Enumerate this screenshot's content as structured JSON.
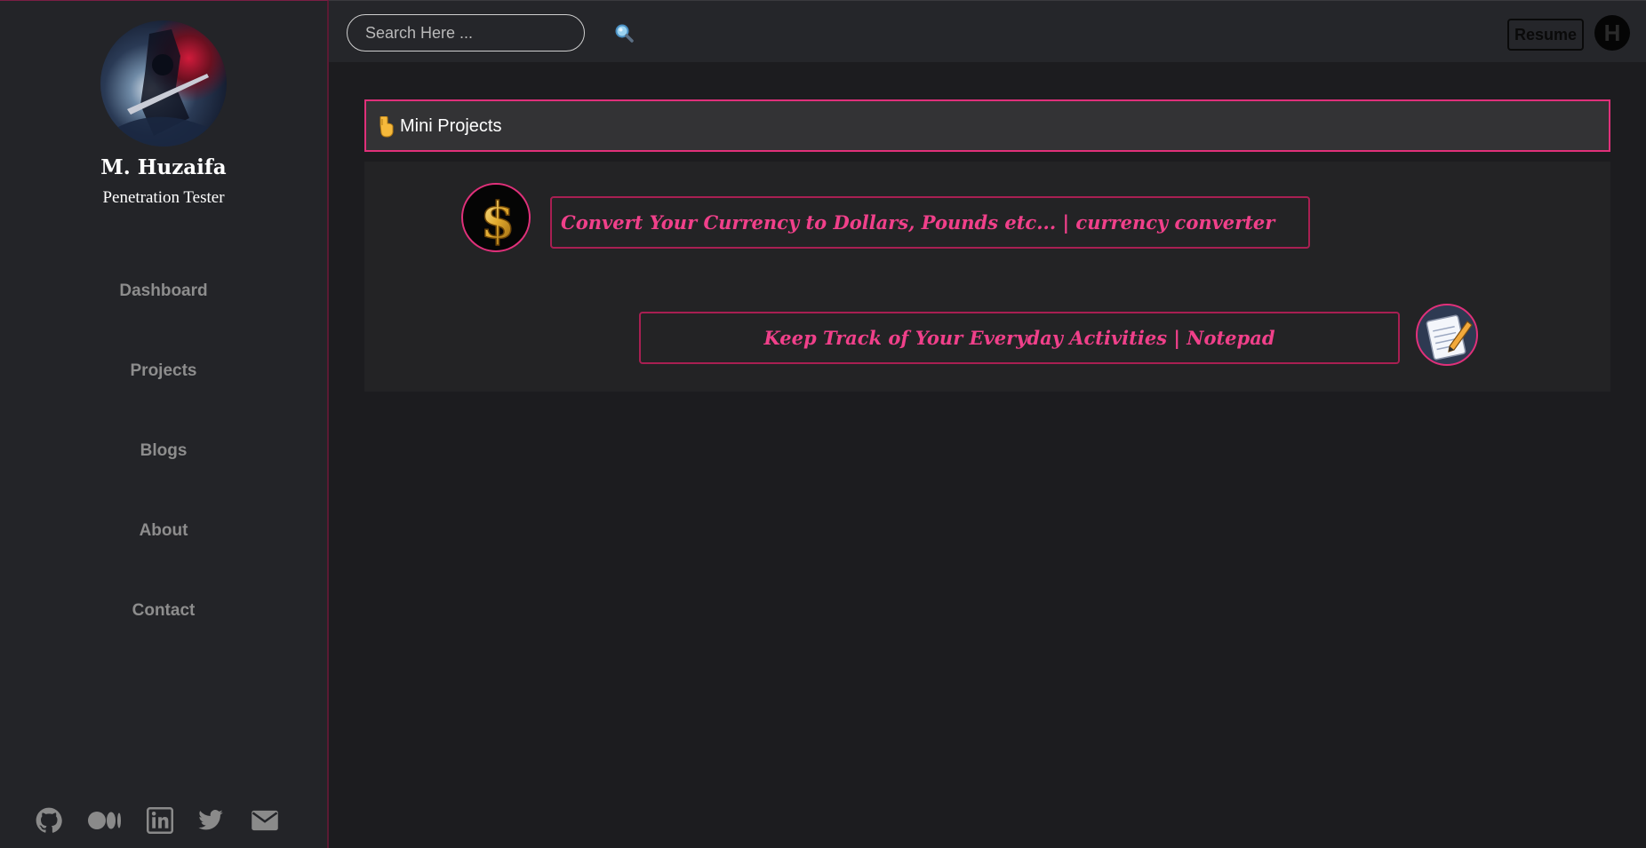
{
  "profile": {
    "name": "M. Huzaifa",
    "role": "Penetration Tester"
  },
  "nav": {
    "items": [
      {
        "label": "Dashboard"
      },
      {
        "label": "Projects"
      },
      {
        "label": "Blogs"
      },
      {
        "label": "About"
      },
      {
        "label": "Contact"
      }
    ]
  },
  "social": [
    "github-icon",
    "medium-icon",
    "linkedin-icon",
    "twitter-icon",
    "envelope-icon"
  ],
  "search": {
    "placeholder": "Search Here ..."
  },
  "header": {
    "resume_label": "Resume",
    "logo_letter": "H"
  },
  "section": {
    "title": "Mini Projects"
  },
  "projects": [
    {
      "label": "Convert Your Currency to Dollars, Pounds etc... | currency converter",
      "icon": "dollar-icon"
    },
    {
      "label": "Keep Track of Your Everyday Activities | Notepad",
      "icon": "notepad-icon"
    }
  ],
  "colors": {
    "accent": "#e0307a",
    "link_text": "#f0408a",
    "sidebar_bg": "#232428",
    "main_bg": "#1c1c1f",
    "nav_text": "#8d8d8d"
  }
}
